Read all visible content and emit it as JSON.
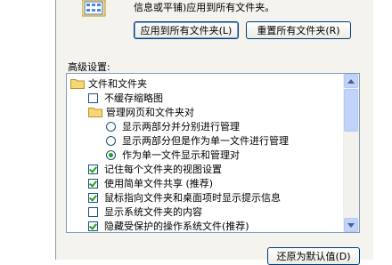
{
  "top": {
    "description": "信息或平铺)应用到所有文件夹。",
    "apply_all_button": "应用到所有文件夹(L)",
    "reset_all_button": "重置所有文件夹(R)"
  },
  "advanced": {
    "label": "高级设置:",
    "items": [
      {
        "type": "folder",
        "label": "文件和文件夹",
        "checked": false
      },
      {
        "type": "checkbox",
        "label": "不缓存缩略图",
        "checked": false
      },
      {
        "type": "folder",
        "label": "管理网页和文件夹对",
        "checked": false
      },
      {
        "type": "radio",
        "label": "显示两部分并分别进行管理",
        "checked": false
      },
      {
        "type": "radio",
        "label": "显示两部分但是作为单一文件进行管理",
        "checked": false
      },
      {
        "type": "radio",
        "label": "作为单一文件显示和管理对",
        "checked": true
      },
      {
        "type": "checkbox",
        "label": "记住每个文件夹的视图设置",
        "checked": true
      },
      {
        "type": "checkbox",
        "label": "使用简单文件共享 (推荐)",
        "checked": true
      },
      {
        "type": "checkbox",
        "label": "鼠标指向文件夹和桌面项时显示提示信息",
        "checked": true
      },
      {
        "type": "checkbox",
        "label": "显示系统文件夹的内容",
        "checked": false
      },
      {
        "type": "checkbox",
        "label": "隐藏受保护的操作系统文件(推荐)",
        "checked": true
      }
    ]
  },
  "restore_button": "还原为默认值(D)",
  "icons": {
    "view": "folder-view-icon",
    "folder": "folder-icon",
    "up": "scroll-up-arrow-icon",
    "down": "scroll-down-arrow-icon"
  }
}
